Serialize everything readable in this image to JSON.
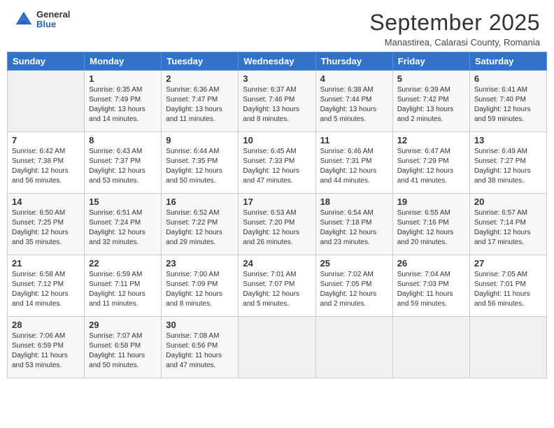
{
  "header": {
    "logo_general": "General",
    "logo_blue": "Blue",
    "month_title": "September 2025",
    "location": "Manastirea, Calarasi County, Romania"
  },
  "days_of_week": [
    "Sunday",
    "Monday",
    "Tuesday",
    "Wednesday",
    "Thursday",
    "Friday",
    "Saturday"
  ],
  "weeks": [
    [
      {
        "day": "",
        "info": ""
      },
      {
        "day": "1",
        "info": "Sunrise: 6:35 AM\nSunset: 7:49 PM\nDaylight: 13 hours\nand 14 minutes."
      },
      {
        "day": "2",
        "info": "Sunrise: 6:36 AM\nSunset: 7:47 PM\nDaylight: 13 hours\nand 11 minutes."
      },
      {
        "day": "3",
        "info": "Sunrise: 6:37 AM\nSunset: 7:46 PM\nDaylight: 13 hours\nand 8 minutes."
      },
      {
        "day": "4",
        "info": "Sunrise: 6:38 AM\nSunset: 7:44 PM\nDaylight: 13 hours\nand 5 minutes."
      },
      {
        "day": "5",
        "info": "Sunrise: 6:39 AM\nSunset: 7:42 PM\nDaylight: 13 hours\nand 2 minutes."
      },
      {
        "day": "6",
        "info": "Sunrise: 6:41 AM\nSunset: 7:40 PM\nDaylight: 12 hours\nand 59 minutes."
      }
    ],
    [
      {
        "day": "7",
        "info": "Sunrise: 6:42 AM\nSunset: 7:38 PM\nDaylight: 12 hours\nand 56 minutes."
      },
      {
        "day": "8",
        "info": "Sunrise: 6:43 AM\nSunset: 7:37 PM\nDaylight: 12 hours\nand 53 minutes."
      },
      {
        "day": "9",
        "info": "Sunrise: 6:44 AM\nSunset: 7:35 PM\nDaylight: 12 hours\nand 50 minutes."
      },
      {
        "day": "10",
        "info": "Sunrise: 6:45 AM\nSunset: 7:33 PM\nDaylight: 12 hours\nand 47 minutes."
      },
      {
        "day": "11",
        "info": "Sunrise: 6:46 AM\nSunset: 7:31 PM\nDaylight: 12 hours\nand 44 minutes."
      },
      {
        "day": "12",
        "info": "Sunrise: 6:47 AM\nSunset: 7:29 PM\nDaylight: 12 hours\nand 41 minutes."
      },
      {
        "day": "13",
        "info": "Sunrise: 6:49 AM\nSunset: 7:27 PM\nDaylight: 12 hours\nand 38 minutes."
      }
    ],
    [
      {
        "day": "14",
        "info": "Sunrise: 6:50 AM\nSunset: 7:25 PM\nDaylight: 12 hours\nand 35 minutes."
      },
      {
        "day": "15",
        "info": "Sunrise: 6:51 AM\nSunset: 7:24 PM\nDaylight: 12 hours\nand 32 minutes."
      },
      {
        "day": "16",
        "info": "Sunrise: 6:52 AM\nSunset: 7:22 PM\nDaylight: 12 hours\nand 29 minutes."
      },
      {
        "day": "17",
        "info": "Sunrise: 6:53 AM\nSunset: 7:20 PM\nDaylight: 12 hours\nand 26 minutes."
      },
      {
        "day": "18",
        "info": "Sunrise: 6:54 AM\nSunset: 7:18 PM\nDaylight: 12 hours\nand 23 minutes."
      },
      {
        "day": "19",
        "info": "Sunrise: 6:55 AM\nSunset: 7:16 PM\nDaylight: 12 hours\nand 20 minutes."
      },
      {
        "day": "20",
        "info": "Sunrise: 6:57 AM\nSunset: 7:14 PM\nDaylight: 12 hours\nand 17 minutes."
      }
    ],
    [
      {
        "day": "21",
        "info": "Sunrise: 6:58 AM\nSunset: 7:12 PM\nDaylight: 12 hours\nand 14 minutes."
      },
      {
        "day": "22",
        "info": "Sunrise: 6:59 AM\nSunset: 7:11 PM\nDaylight: 12 hours\nand 11 minutes."
      },
      {
        "day": "23",
        "info": "Sunrise: 7:00 AM\nSunset: 7:09 PM\nDaylight: 12 hours\nand 8 minutes."
      },
      {
        "day": "24",
        "info": "Sunrise: 7:01 AM\nSunset: 7:07 PM\nDaylight: 12 hours\nand 5 minutes."
      },
      {
        "day": "25",
        "info": "Sunrise: 7:02 AM\nSunset: 7:05 PM\nDaylight: 12 hours\nand 2 minutes."
      },
      {
        "day": "26",
        "info": "Sunrise: 7:04 AM\nSunset: 7:03 PM\nDaylight: 11 hours\nand 59 minutes."
      },
      {
        "day": "27",
        "info": "Sunrise: 7:05 AM\nSunset: 7:01 PM\nDaylight: 11 hours\nand 56 minutes."
      }
    ],
    [
      {
        "day": "28",
        "info": "Sunrise: 7:06 AM\nSunset: 6:59 PM\nDaylight: 11 hours\nand 53 minutes."
      },
      {
        "day": "29",
        "info": "Sunrise: 7:07 AM\nSunset: 6:58 PM\nDaylight: 11 hours\nand 50 minutes."
      },
      {
        "day": "30",
        "info": "Sunrise: 7:08 AM\nSunset: 6:56 PM\nDaylight: 11 hours\nand 47 minutes."
      },
      {
        "day": "",
        "info": ""
      },
      {
        "day": "",
        "info": ""
      },
      {
        "day": "",
        "info": ""
      },
      {
        "day": "",
        "info": ""
      }
    ]
  ]
}
